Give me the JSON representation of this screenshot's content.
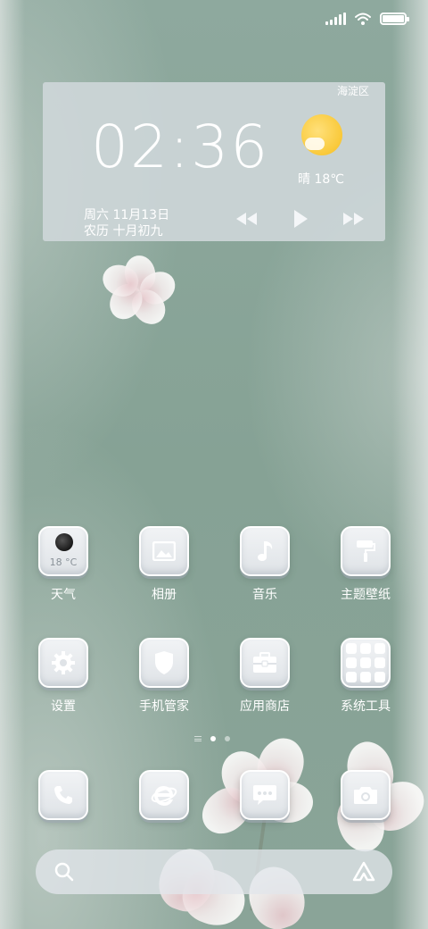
{
  "status_bar": {
    "signal_icon": "signal-bars-icon",
    "wifi_icon": "wifi-icon",
    "battery_icon": "battery-icon",
    "battery_level": 1.0
  },
  "widget": {
    "district": "海淀区",
    "time": "02:36",
    "weather_icon": "sun-icon",
    "weather": "晴 18℃",
    "date_line1": "周六 11月13日",
    "date_line2": "农历 十月初九",
    "controls": [
      "rewind-icon",
      "play-icon",
      "fast-forward-icon"
    ]
  },
  "apps_row1": [
    {
      "label": "天气",
      "icon": "moon-weather-icon",
      "badge": "18 °C"
    },
    {
      "label": "相册",
      "icon": "picture-icon"
    },
    {
      "label": "音乐",
      "icon": "music-note-icon"
    },
    {
      "label": "主题壁纸",
      "icon": "paint-roller-icon"
    }
  ],
  "apps_row2": [
    {
      "label": "设置",
      "icon": "gear-icon"
    },
    {
      "label": "手机管家",
      "icon": "shield-icon"
    },
    {
      "label": "应用商店",
      "icon": "briefcase-icon"
    },
    {
      "label": "系统工具",
      "icon": "folder-grid-icon"
    }
  ],
  "page_indicator": {
    "pages": 3,
    "current": 1
  },
  "dock": [
    {
      "name": "phone",
      "icon": "phone-icon"
    },
    {
      "name": "browser",
      "icon": "browser-e-icon"
    },
    {
      "name": "messages",
      "icon": "chat-bubble-icon"
    },
    {
      "name": "camera",
      "icon": "camera-icon"
    }
  ],
  "search_bar": {
    "search_icon": "search-icon",
    "assistant_icon": "assistant-icon"
  }
}
